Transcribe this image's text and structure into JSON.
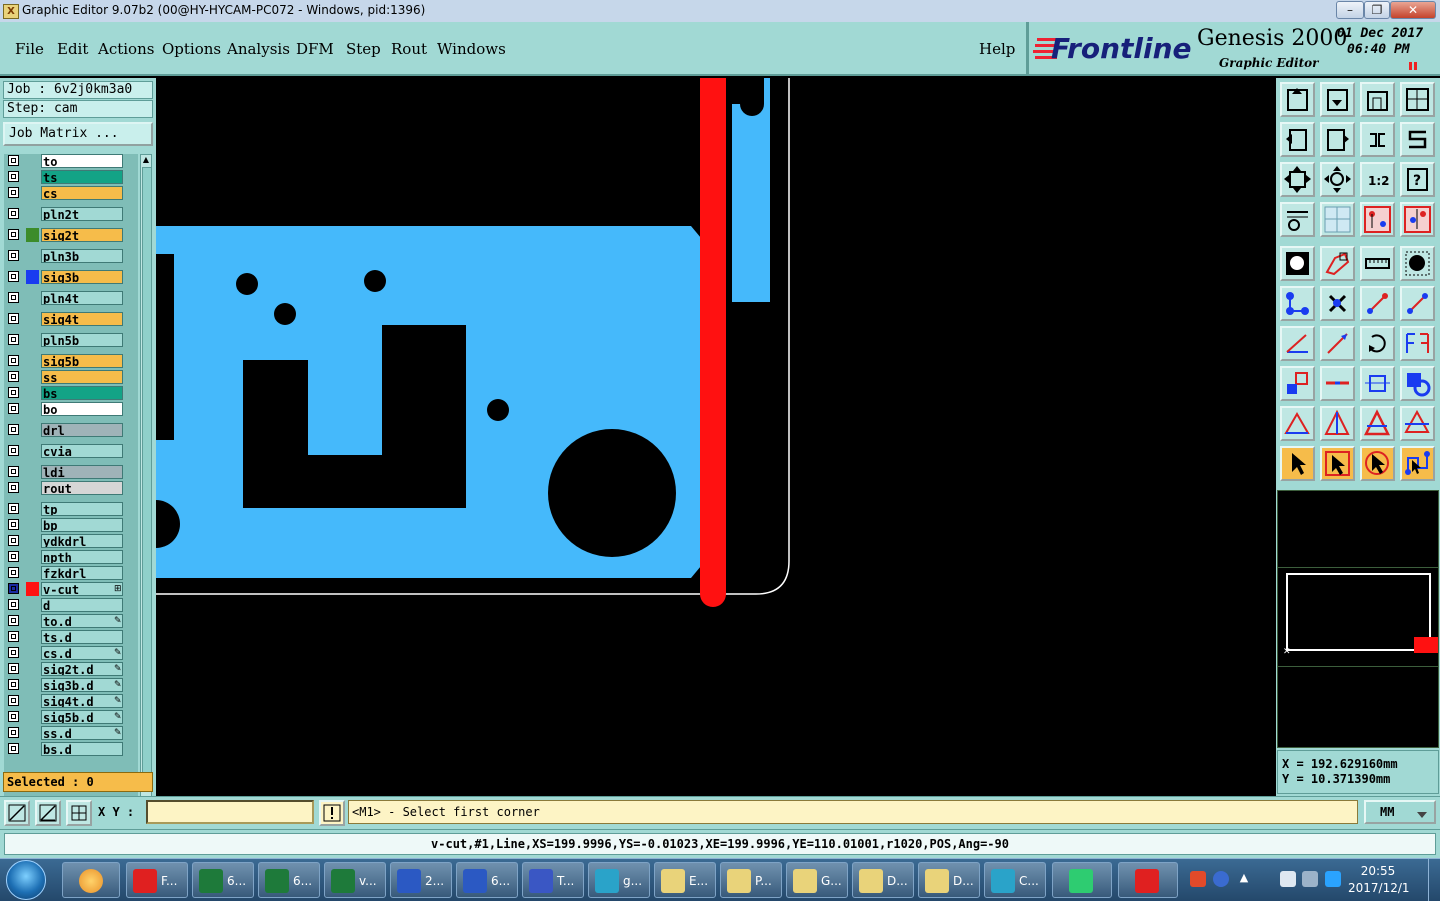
{
  "window": {
    "title": "Graphic Editor 9.07b2 (00@HY-HYCAM-PC072 - Windows, pid:1396)",
    "app_icon": "X",
    "controls": [
      "minimize-icon",
      "maximize-icon",
      "close-icon"
    ]
  },
  "menu": {
    "items": [
      "File",
      "Edit",
      "Actions",
      "Options",
      "Analysis",
      "DFM",
      "Step",
      "Rout",
      "Windows"
    ],
    "help": "Help"
  },
  "brand": {
    "logo": "Frontline",
    "product": "Genesis 2000",
    "subtitle": "Graphic Editor",
    "date": "01 Dec 2017",
    "time": "06:40 PM"
  },
  "job": {
    "job_label": "Job : 6v2j0km3a0",
    "step_label": "Step: cam",
    "matrix_button": "Job Matrix ..."
  },
  "layers": [
    {
      "name": "to",
      "bg": "#ffffff",
      "color": "",
      "mark": ""
    },
    {
      "name": "ts",
      "bg": "#13a386",
      "color": "",
      "mark": ""
    },
    {
      "name": "cs",
      "bg": "#f6bc4a",
      "color": "",
      "mark": ""
    },
    {
      "name": "pln2t",
      "bg": "#a1d9d4",
      "color": "",
      "mark": ""
    },
    {
      "name": "sig2t",
      "bg": "#f6bc4a",
      "color": "#3c8c2a",
      "mark": ""
    },
    {
      "name": "pln3b",
      "bg": "#a1d9d4",
      "color": "",
      "mark": ""
    },
    {
      "name": "sig3b",
      "bg": "#f6bc4a",
      "color": "#1a3cf0",
      "mark": ""
    },
    {
      "name": "pln4t",
      "bg": "#a1d9d4",
      "color": "",
      "mark": ""
    },
    {
      "name": "sig4t",
      "bg": "#f6bc4a",
      "color": "",
      "mark": ""
    },
    {
      "name": "pln5b",
      "bg": "#a1d9d4",
      "color": "",
      "mark": ""
    },
    {
      "name": "sig5b",
      "bg": "#f6bc4a",
      "color": "",
      "mark": ""
    },
    {
      "name": "ss",
      "bg": "#f6bc4a",
      "color": "",
      "mark": ""
    },
    {
      "name": "bs",
      "bg": "#13a386",
      "color": "",
      "mark": ""
    },
    {
      "name": "bo",
      "bg": "#ffffff",
      "color": "",
      "mark": ""
    },
    {
      "name": "drl",
      "bg": "#9fb3b8",
      "color": "",
      "mark": ""
    },
    {
      "name": "cvia",
      "bg": "#a1d9d4",
      "color": "",
      "mark": ""
    },
    {
      "name": "ldi",
      "bg": "#9fb3b8",
      "color": "",
      "mark": ""
    },
    {
      "name": "rout",
      "bg": "#d6d6d6",
      "color": "",
      "mark": ""
    },
    {
      "name": "tp",
      "bg": "#a1d9d4",
      "color": "",
      "mark": ""
    },
    {
      "name": "bp",
      "bg": "#a1d9d4",
      "color": "",
      "mark": ""
    },
    {
      "name": "ydkdrl",
      "bg": "#a1d9d4",
      "color": "",
      "mark": ""
    },
    {
      "name": "npth",
      "bg": "#a1d9d4",
      "color": "",
      "mark": ""
    },
    {
      "name": "fzkdrl",
      "bg": "#a1d9d4",
      "color": "",
      "mark": ""
    },
    {
      "name": "v-cut",
      "bg": "#a1d9d4",
      "color": "#ff1111",
      "mark": "⊞",
      "active": true
    },
    {
      "name": "d",
      "bg": "#a1d9d4",
      "color": "",
      "mark": ""
    },
    {
      "name": "to.d",
      "bg": "#a1d9d4",
      "color": "",
      "mark": "✎"
    },
    {
      "name": "ts.d",
      "bg": "#a1d9d4",
      "color": "",
      "mark": ""
    },
    {
      "name": "cs.d",
      "bg": "#a1d9d4",
      "color": "",
      "mark": "✎"
    },
    {
      "name": "sig2t.d",
      "bg": "#a1d9d4",
      "color": "",
      "mark": "✎"
    },
    {
      "name": "sig3b.d",
      "bg": "#a1d9d4",
      "color": "",
      "mark": "✎"
    },
    {
      "name": "sig4t.d",
      "bg": "#a1d9d4",
      "color": "",
      "mark": "✎"
    },
    {
      "name": "sig5b.d",
      "bg": "#a1d9d4",
      "color": "",
      "mark": "✎"
    },
    {
      "name": "ss.d",
      "bg": "#a1d9d4",
      "color": "",
      "mark": "✎"
    },
    {
      "name": "bs.d",
      "bg": "#a1d9d4",
      "color": "",
      "mark": ""
    }
  ],
  "selected_label": "Selected : 0",
  "coords": {
    "x": "X  =  192.629160mm",
    "y": "Y  =  10.371390mm"
  },
  "command": {
    "xy_label": "X Y :",
    "xy_value": "",
    "prompt": "<M1> - Select first corner",
    "units": "MM"
  },
  "status": "v-cut,#1,Line,XS=199.9996,YS=-0.01023,XE=199.9996,YE=110.01001,r1020,POS,Ang=-90",
  "toolbox": {
    "scale_label": "1:2",
    "rows": [
      [
        "open-step-icon",
        "save-icon",
        "home-icon",
        "window-layout-icon"
      ],
      [
        "undo-zoom-icon",
        "redo-zoom-icon",
        "pan-icon",
        "snap-icon"
      ],
      [
        "zoom-fit-icon",
        "zoom-center-icon",
        "scale-icon",
        "help-icon"
      ],
      [
        "tool-settings-icon",
        "grid-icon",
        "layer-view-icon",
        "layer-compare-icon"
      ],
      [
        "pad-icon",
        "polygon-icon",
        "ruler-icon",
        "round-pad-icon"
      ],
      [
        "net-icon",
        "delete-feature-icon",
        "line-add-icon",
        "line-add2-icon"
      ],
      [
        "angle-icon",
        "slope-icon",
        "rotate-icon",
        "mirror-icon"
      ],
      [
        "move-icon",
        "split-icon",
        "resize-icon",
        "group-icon"
      ],
      [
        "triangle-icon",
        "triangle-up-icon",
        "triangle-a-icon",
        "triangle-b-icon"
      ],
      [
        "pointer-icon",
        "pointer-box-icon",
        "pointer-circle-icon",
        "route-icon"
      ]
    ]
  },
  "taskbar": {
    "items": [
      {
        "label": "F...",
        "icon": "#e02020"
      },
      {
        "label": "6...",
        "icon": "#1e7a3a"
      },
      {
        "label": "6...",
        "icon": "#1e7a3a"
      },
      {
        "label": "v...",
        "icon": "#1e7a3a"
      },
      {
        "label": "2...",
        "icon": "#2b59c3"
      },
      {
        "label": "6...",
        "icon": "#2b59c3"
      },
      {
        "label": "T...",
        "icon": "#3a57c4"
      },
      {
        "label": "g...",
        "icon": "#2aa3c9"
      },
      {
        "label": "E...",
        "icon": "#e9d37a"
      },
      {
        "label": "P...",
        "icon": "#e9d37a"
      },
      {
        "label": "G...",
        "icon": "#e9d37a"
      },
      {
        "label": "D...",
        "icon": "#e9d37a"
      },
      {
        "label": "D...",
        "icon": "#e9d37a"
      },
      {
        "label": "C...",
        "icon": "#2aa3c9"
      }
    ],
    "clock_time": "20:55",
    "clock_date": "2017/12/1"
  }
}
